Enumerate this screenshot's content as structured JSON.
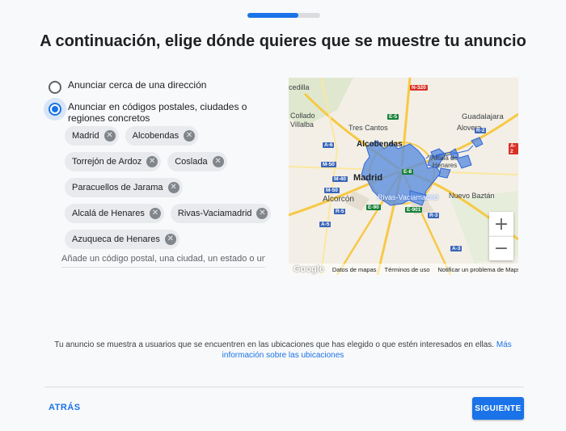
{
  "progress": {
    "fraction": 0.7
  },
  "title": "A continuación, elige dónde quieres que se muestre tu anuncio",
  "options": [
    {
      "label": "Anunciar cerca de una dirección",
      "checked": false
    },
    {
      "label": "Anunciar en códigos postales, ciudades o regiones concretos",
      "checked": true
    }
  ],
  "locations": [
    "Madrid",
    "Alcobendas",
    "Torrejón de Ardoz",
    "Coslada",
    "Paracuellos de Jarama",
    "Alcalá de Henares",
    "Rivas-Vaciamadrid",
    "Azuqueca de Henares"
  ],
  "search": {
    "placeholder": "Añade un código postal, una ciudad, un estado o un país",
    "value": ""
  },
  "map": {
    "zoom_in": "+",
    "zoom_out": "−",
    "logo": "Google",
    "footer": {
      "map_data": "Datos de mapas",
      "terms": "Términos de uso",
      "report": "Notificar un problema de Maps"
    },
    "labels": {
      "cedilla": "cedilla",
      "collado": "Collado",
      "villalba": "Villalba",
      "tres_cantos": "Tres Cantos",
      "alcobendas": "Alcobendas",
      "madrid": "Madrid",
      "alcorcon": "Alcorcón",
      "rivas": "Rivas-Vaciamadrid",
      "alovera": "Alovera",
      "guadalajara": "Guadalajara",
      "alcala1": "Alcalá de",
      "alcala2": "Henares",
      "nuevo_baztan": "Nuevo Baztán"
    },
    "roads": {
      "n320": "N-320",
      "e5": "E-5",
      "a6": "A-6",
      "m50a": "M-50",
      "m40": "M-40",
      "m50b": "M-50",
      "r5": "R-5",
      "a5": "A-5",
      "r2": "R-2",
      "e90": "E-90",
      "e901": "E-901",
      "r3": "R-3",
      "a3": "A-3",
      "e8": "E-8",
      "a2": "A-2"
    },
    "colors": {
      "region_fill": "#5b8fe0",
      "region_stroke": "#3367d6"
    }
  },
  "info": {
    "text": "Tu anuncio se muestra a usuarios que se encuentren en las ubicaciones que has elegido o que estén interesados en ellas.",
    "link": "Más información sobre las ubicaciones"
  },
  "nav": {
    "back": "ATRÁS",
    "next": "SIGUIENTE"
  }
}
